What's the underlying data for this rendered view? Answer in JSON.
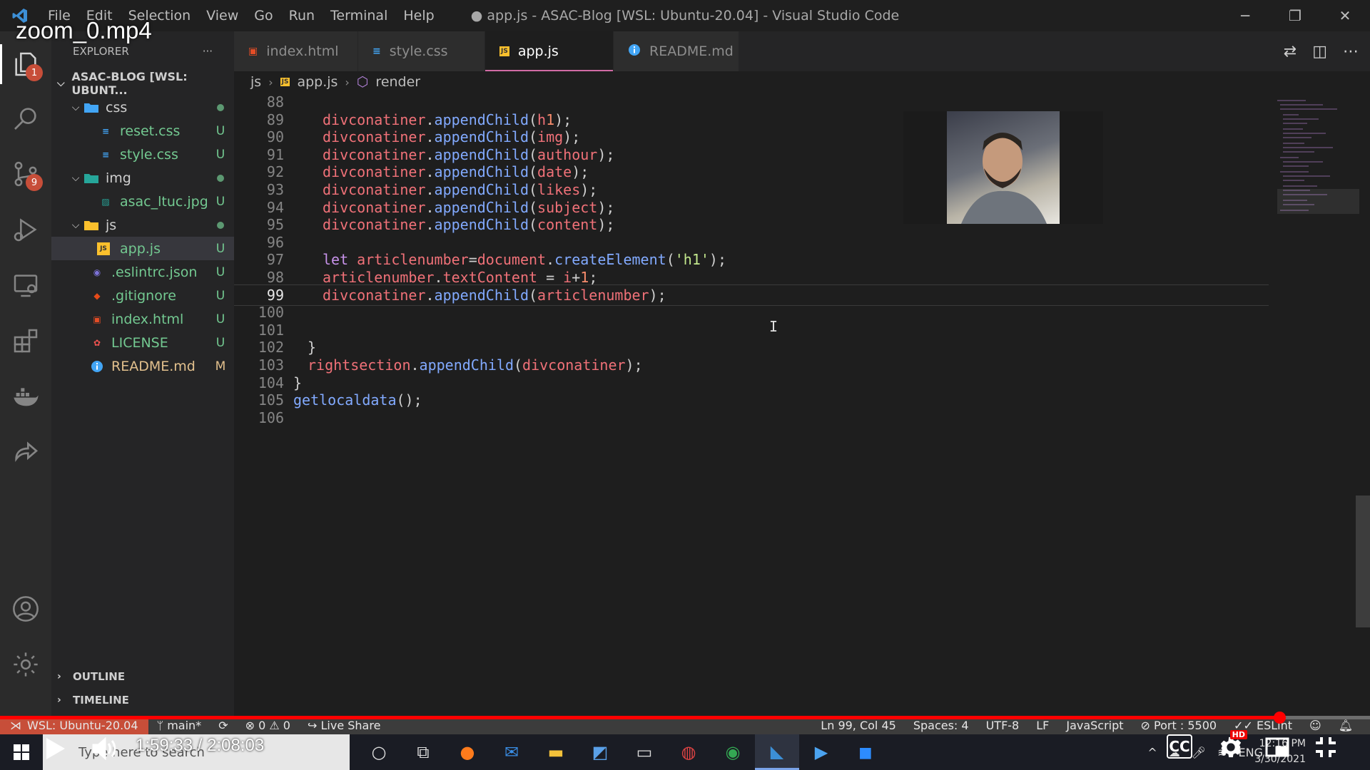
{
  "video": {
    "title": "zoom_0.mp4",
    "time_current": "1:59:33",
    "time_separator": "/",
    "time_total": "2:08:03",
    "progress_fraction": 0.934
  },
  "window": {
    "title": "● app.js - ASAC-Blog [WSL: Ubuntu-20.04] - Visual Studio Code",
    "menus": [
      "File",
      "Edit",
      "Selection",
      "View",
      "Go",
      "Run",
      "Terminal",
      "Help"
    ]
  },
  "activity_bar": {
    "explorer_badge": "1",
    "scm_badge": "9"
  },
  "sidebar": {
    "header": "EXPLORER",
    "more": "···",
    "project": "ASAC-BLOG [WSL: UBUNT...",
    "items": [
      {
        "name": "css",
        "status": "",
        "kind": "folder"
      },
      {
        "name": "reset.css",
        "status": "U",
        "kind": "css"
      },
      {
        "name": "style.css",
        "status": "U",
        "kind": "css"
      },
      {
        "name": "img",
        "status": "",
        "kind": "folder"
      },
      {
        "name": "asac_ltuc.jpg",
        "status": "U",
        "kind": "image"
      },
      {
        "name": "js",
        "status": "",
        "kind": "folder"
      },
      {
        "name": "app.js",
        "status": "U",
        "kind": "js"
      },
      {
        "name": ".eslintrc.json",
        "status": "U",
        "kind": "eslint"
      },
      {
        "name": ".gitignore",
        "status": "U",
        "kind": "git"
      },
      {
        "name": "index.html",
        "status": "U",
        "kind": "html"
      },
      {
        "name": "LICENSE",
        "status": "U",
        "kind": "license"
      },
      {
        "name": "README.md",
        "status": "M",
        "kind": "info"
      }
    ],
    "outline": "OUTLINE",
    "timeline": "TIMELINE"
  },
  "tabs": [
    {
      "label": "index.html",
      "icon": "html-file-icon"
    },
    {
      "label": "style.css",
      "icon": "css-file-icon"
    },
    {
      "label": "app.js",
      "icon": "js-file-icon",
      "active": true,
      "modified": true
    },
    {
      "label": "README.md",
      "icon": "info-icon"
    }
  ],
  "breadcrumb": {
    "folder": "js",
    "file": "app.js",
    "symbol": "render"
  },
  "editor": {
    "current_line": 99,
    "lines": [
      {
        "n": "88",
        "text": ""
      },
      {
        "n": "89",
        "text": "divconatiner.appendChild(h1);"
      },
      {
        "n": "90",
        "text": "divconatiner.appendChild(img);"
      },
      {
        "n": "91",
        "text": "divconatiner.appendChild(authour);"
      },
      {
        "n": "92",
        "text": "divconatiner.appendChild(date);"
      },
      {
        "n": "93",
        "text": "divconatiner.appendChild(likes);"
      },
      {
        "n": "94",
        "text": "divconatiner.appendChild(subject);"
      },
      {
        "n": "95",
        "text": "divconatiner.appendChild(content);"
      },
      {
        "n": "96",
        "text": ""
      },
      {
        "n": "97",
        "text": "let articlenumber=document.createElement('h1');"
      },
      {
        "n": "98",
        "text": "articlenumber.textContent = i+1;"
      },
      {
        "n": "99",
        "text": "divconatiner.appendChild(articlenumber);"
      },
      {
        "n": "100",
        "text": ""
      },
      {
        "n": "101",
        "text": ""
      },
      {
        "n": "102",
        "text": "}"
      },
      {
        "n": "103",
        "text": "rightsection.appendChild(divconatiner);"
      },
      {
        "n": "104",
        "text": "}"
      },
      {
        "n": "105",
        "text": "getlocaldata();"
      },
      {
        "n": "106",
        "text": ""
      }
    ]
  },
  "statusbar": {
    "remote": "WSL: Ubuntu-20.04",
    "branch": "main*",
    "errors": "0",
    "warnings": "0",
    "live_share": "Live Share",
    "position": "Ln 99, Col 45",
    "spaces": "Spaces: 4",
    "encoding": "UTF-8",
    "eol": "LF",
    "language": "JavaScript",
    "port": "Port : 5500",
    "eslint": "ESLint"
  },
  "taskbar": {
    "search_placeholder": "Type here to search",
    "lang": "ENG",
    "time": "12:16 PM",
    "date": "3/30/2021"
  },
  "player": {
    "cc": "CC",
    "hd": "HD"
  },
  "colors": {
    "accent_tab": "#d16ba5",
    "remote_bg": "#c74e39",
    "progress": "#ff0000"
  }
}
